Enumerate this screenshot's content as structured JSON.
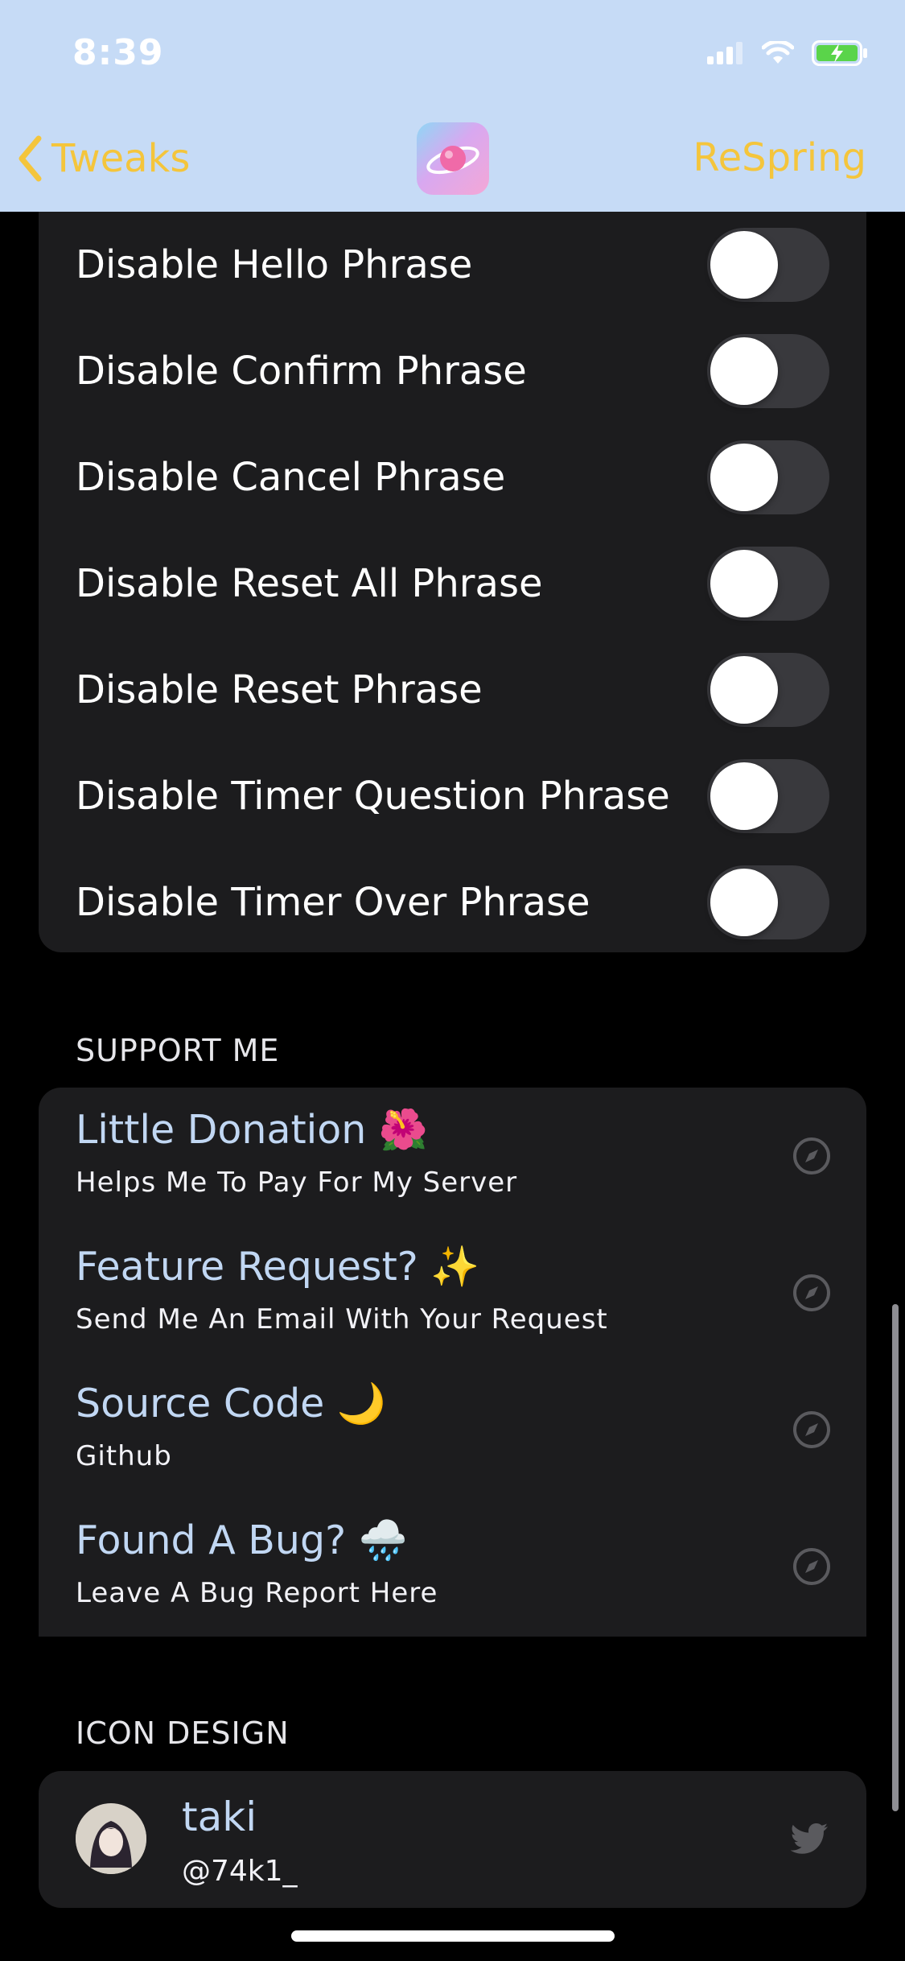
{
  "status_bar": {
    "time": "8:39"
  },
  "nav": {
    "back_label": "Tweaks",
    "right_label": "ReSpring",
    "accent_color": "#f4c53c"
  },
  "toggles": [
    {
      "label": "Disable Hello Phrase",
      "on": false
    },
    {
      "label": "Disable Confirm Phrase",
      "on": false
    },
    {
      "label": "Disable Cancel Phrase",
      "on": false
    },
    {
      "label": "Disable Reset All Phrase",
      "on": false
    },
    {
      "label": "Disable Reset Phrase",
      "on": false
    },
    {
      "label": "Disable Timer Question Phrase",
      "on": false
    },
    {
      "label": "Disable Timer Over Phrase",
      "on": false
    }
  ],
  "support": {
    "header": "SUPPORT ME",
    "items": [
      {
        "title": "Little Donation 🌺",
        "subtitle": "Helps Me To Pay For My Server",
        "icon": "compass-icon"
      },
      {
        "title": "Feature Request? ✨",
        "subtitle": "Send Me An Email With Your Request",
        "icon": "compass-icon"
      },
      {
        "title": "Source Code 🌙",
        "subtitle": "Github",
        "icon": "compass-icon"
      },
      {
        "title": "Found A Bug? 🌧️",
        "subtitle": "Leave A Bug Report Here",
        "icon": "compass-icon"
      }
    ]
  },
  "icon_design": {
    "header": "ICON DESIGN",
    "name": "taki",
    "handle": "@74k1_",
    "icon": "twitter-icon"
  }
}
